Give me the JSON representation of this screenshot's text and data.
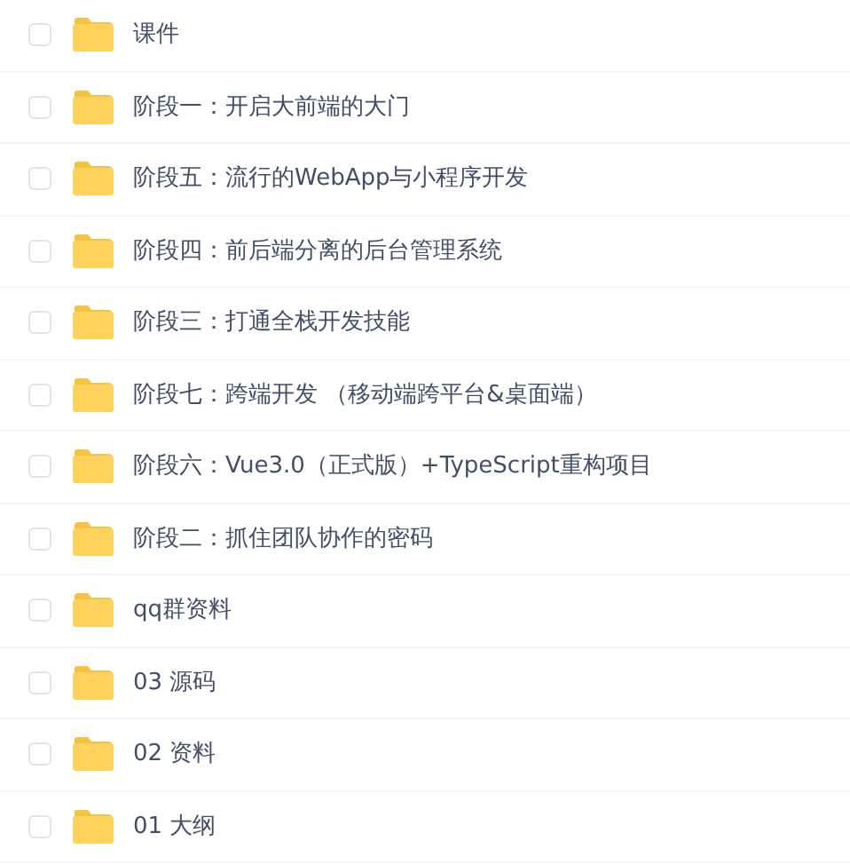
{
  "files": [
    {
      "name": "课件",
      "checked": false
    },
    {
      "name": "阶段一：开启大前端的大门",
      "checked": false
    },
    {
      "name": "阶段五：流行的WebApp与小程序开发",
      "checked": false
    },
    {
      "name": "阶段四：前后端分离的后台管理系统",
      "checked": false
    },
    {
      "name": "阶段三：打通全栈开发技能",
      "checked": false
    },
    {
      "name": "阶段七：跨端开发 （移动端跨平台&桌面端）",
      "checked": false
    },
    {
      "name": "阶段六：Vue3.0（正式版）+TypeScript重构项目",
      "checked": false
    },
    {
      "name": "阶段二：抓住团队协作的密码",
      "checked": false
    },
    {
      "name": "qq群资料",
      "checked": false
    },
    {
      "name": "03 源码",
      "checked": false
    },
    {
      "name": "02 资料",
      "checked": false
    },
    {
      "name": "01 大纲",
      "checked": false
    }
  ]
}
